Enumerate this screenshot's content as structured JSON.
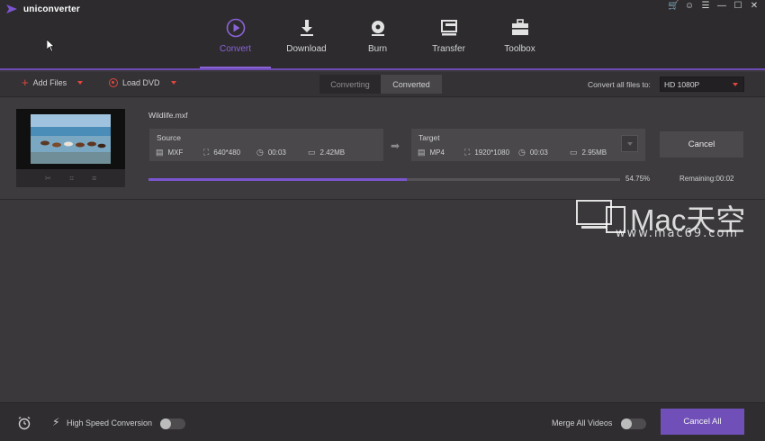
{
  "app": {
    "title": "uniconverter"
  },
  "window_controls": [
    "cart-icon",
    "user-icon",
    "menu-icon",
    "minimize-icon",
    "maximize-icon",
    "close-icon"
  ],
  "nav": {
    "items": [
      {
        "label": "Convert",
        "icon": "play-circle-icon",
        "active": true
      },
      {
        "label": "Download",
        "icon": "download-icon",
        "active": false
      },
      {
        "label": "Burn",
        "icon": "disc-icon",
        "active": false
      },
      {
        "label": "Transfer",
        "icon": "transfer-icon",
        "active": false
      },
      {
        "label": "Toolbox",
        "icon": "toolbox-icon",
        "active": false
      }
    ],
    "accent": "#8b63d9"
  },
  "toolbar": {
    "add_files": "Add Files",
    "load_dvd": "Load DVD",
    "tabs": [
      "Converting",
      "Converted"
    ],
    "convert_all_label": "Convert all files to:",
    "convert_all_value": "HD 1080P"
  },
  "file": {
    "name": "Wildlife.mxf",
    "source": {
      "label": "Source",
      "format": "MXF",
      "resolution": "640*480",
      "duration": "00:03",
      "size": "2.42MB"
    },
    "target": {
      "label": "Target",
      "format": "MP4",
      "resolution": "1920*1080",
      "duration": "00:03",
      "size": "2.95MB"
    },
    "cancel_label": "Cancel",
    "progress_percent": 54.75,
    "progress_text": "54.75%",
    "remaining": "Remaining:00:02"
  },
  "watermark": {
    "title": "Mac天空",
    "url": "www.mac69.com"
  },
  "bottom": {
    "high_speed_label": "High Speed Conversion",
    "high_speed_on": false,
    "merge_label": "Merge All Videos",
    "merge_on": false,
    "cancel_all": "Cancel All"
  },
  "colors": {
    "accent": "#7a55cf",
    "red": "#e0463c",
    "background": "#3a383b"
  }
}
